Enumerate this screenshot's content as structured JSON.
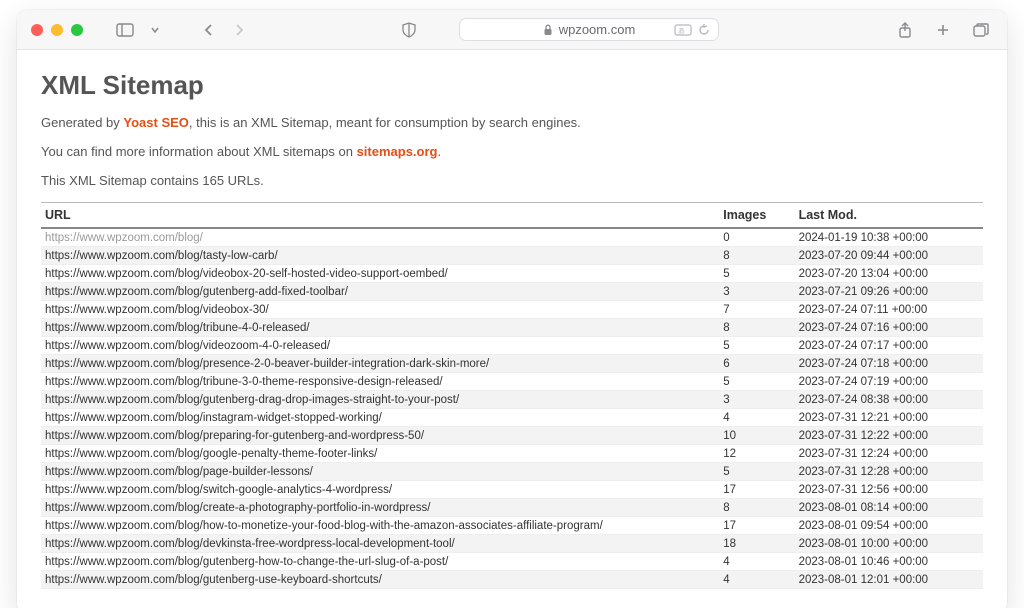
{
  "browser": {
    "address": "wpzoom.com"
  },
  "page": {
    "title": "XML Sitemap",
    "intro_prefix": "Generated by ",
    "intro_link": "Yoast SEO",
    "intro_suffix": ", this is an XML Sitemap, meant for consumption by search engines.",
    "more_prefix": "You can find more information about XML sitemaps on ",
    "more_link": "sitemaps.org",
    "more_suffix": ".",
    "count_text": "This XML Sitemap contains 165 URLs."
  },
  "table": {
    "headers": {
      "url": "URL",
      "images": "Images",
      "lastmod": "Last Mod."
    },
    "rows": [
      {
        "url": "https://www.wpzoom.com/blog/",
        "images": "0",
        "lastmod": "2024-01-19 10:38 +00:00"
      },
      {
        "url": "https://www.wpzoom.com/blog/tasty-low-carb/",
        "images": "8",
        "lastmod": "2023-07-20 09:44 +00:00"
      },
      {
        "url": "https://www.wpzoom.com/blog/videobox-20-self-hosted-video-support-oembed/",
        "images": "5",
        "lastmod": "2023-07-20 13:04 +00:00"
      },
      {
        "url": "https://www.wpzoom.com/blog/gutenberg-add-fixed-toolbar/",
        "images": "3",
        "lastmod": "2023-07-21 09:26 +00:00"
      },
      {
        "url": "https://www.wpzoom.com/blog/videobox-30/",
        "images": "7",
        "lastmod": "2023-07-24 07:11 +00:00"
      },
      {
        "url": "https://www.wpzoom.com/blog/tribune-4-0-released/",
        "images": "8",
        "lastmod": "2023-07-24 07:16 +00:00"
      },
      {
        "url": "https://www.wpzoom.com/blog/videozoom-4-0-released/",
        "images": "5",
        "lastmod": "2023-07-24 07:17 +00:00"
      },
      {
        "url": "https://www.wpzoom.com/blog/presence-2-0-beaver-builder-integration-dark-skin-more/",
        "images": "6",
        "lastmod": "2023-07-24 07:18 +00:00"
      },
      {
        "url": "https://www.wpzoom.com/blog/tribune-3-0-theme-responsive-design-released/",
        "images": "5",
        "lastmod": "2023-07-24 07:19 +00:00"
      },
      {
        "url": "https://www.wpzoom.com/blog/gutenberg-drag-drop-images-straight-to-your-post/",
        "images": "3",
        "lastmod": "2023-07-24 08:38 +00:00"
      },
      {
        "url": "https://www.wpzoom.com/blog/instagram-widget-stopped-working/",
        "images": "4",
        "lastmod": "2023-07-31 12:21 +00:00"
      },
      {
        "url": "https://www.wpzoom.com/blog/preparing-for-gutenberg-and-wordpress-50/",
        "images": "10",
        "lastmod": "2023-07-31 12:22 +00:00"
      },
      {
        "url": "https://www.wpzoom.com/blog/google-penalty-theme-footer-links/",
        "images": "12",
        "lastmod": "2023-07-31 12:24 +00:00"
      },
      {
        "url": "https://www.wpzoom.com/blog/page-builder-lessons/",
        "images": "5",
        "lastmod": "2023-07-31 12:28 +00:00"
      },
      {
        "url": "https://www.wpzoom.com/blog/switch-google-analytics-4-wordpress/",
        "images": "17",
        "lastmod": "2023-07-31 12:56 +00:00"
      },
      {
        "url": "https://www.wpzoom.com/blog/create-a-photography-portfolio-in-wordpress/",
        "images": "8",
        "lastmod": "2023-08-01 08:14 +00:00"
      },
      {
        "url": "https://www.wpzoom.com/blog/how-to-monetize-your-food-blog-with-the-amazon-associates-affiliate-program/",
        "images": "17",
        "lastmod": "2023-08-01 09:54 +00:00"
      },
      {
        "url": "https://www.wpzoom.com/blog/devkinsta-free-wordpress-local-development-tool/",
        "images": "18",
        "lastmod": "2023-08-01 10:00 +00:00"
      },
      {
        "url": "https://www.wpzoom.com/blog/gutenberg-how-to-change-the-url-slug-of-a-post/",
        "images": "4",
        "lastmod": "2023-08-01 10:46 +00:00"
      },
      {
        "url": "https://www.wpzoom.com/blog/gutenberg-use-keyboard-shortcuts/",
        "images": "4",
        "lastmod": "2023-08-01 12:01 +00:00"
      }
    ]
  }
}
